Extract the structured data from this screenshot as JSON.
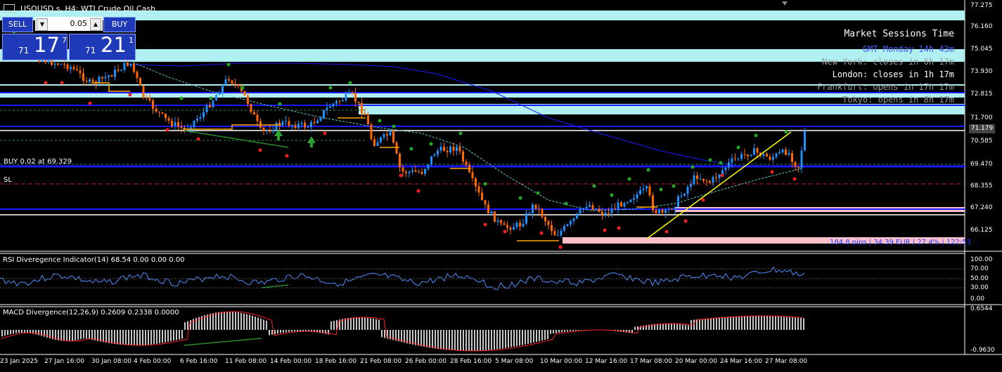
{
  "window": {
    "symbol_title": "USOUSD.s, H4:  WTI Crude Oil Cash"
  },
  "trade_panel": {
    "sell_label": "SELL",
    "buy_label": "BUY",
    "lot_value": "0.05",
    "sell_price_small": "71",
    "sell_price_big": "17",
    "sell_price_sup": "7",
    "buy_price_small": "71",
    "buy_price_big": "21",
    "buy_price_sup": "1"
  },
  "sessions": {
    "title": "Market Sessions Time",
    "gmt": "GMT Monday 14h 43m",
    "new_york": "New York: closes in 6h 17m",
    "london": "London: closes in 1h 17m",
    "frankfurt": "Frankfurt: opens in 17h 17m",
    "tokyo": "Tokyo: opens in 8h 17m"
  },
  "levels": {
    "buy_label": "BUY 0.02 at 69.329",
    "sl_label": "SL",
    "pips_label": "184.8 pips | 34.39 EUR | 27.4% | 122:53"
  },
  "price_axis": {
    "labels": [
      "77.275",
      "76.160",
      "75.045",
      "73.930",
      "72.815",
      "71.700",
      "70.585",
      "69.470",
      "68.355",
      "67.240",
      "66.125"
    ],
    "current_price": "71.179"
  },
  "rsi": {
    "title": "RSI Diveregence Indicator(14) 68.54 0.00 0.00 0.00",
    "levels": [
      "100.00",
      "70.00",
      "50.00",
      "30.00",
      "0.00"
    ]
  },
  "macd": {
    "title": "MACD Divergence(12,26,9) 0.2609 0.2338 0.0000",
    "levels": [
      "0.6544",
      "-0.9630"
    ]
  },
  "time_axis": {
    "labels": [
      "23 Jan 2025",
      "27 Jan 16:00",
      "30 Jan 08:00",
      "4 Feb 00:00",
      "6 Feb 16:00",
      "11 Feb 08:00",
      "14 Feb 00:00",
      "18 Feb 16:00",
      "21 Feb 08:00",
      "26 Feb 00:00",
      "28 Feb 16:00",
      "5 Mar 08:00",
      "10 Mar 00:00",
      "12 Mar 16:00",
      "17 Mar 08:00",
      "20 Mar 00:00",
      "24 Mar 16:00",
      "27 Mar 08:00"
    ]
  },
  "colors": {
    "background": "#000000",
    "bull_candle": "#1e90ff",
    "bear_candle": "#ff6600",
    "zone_cyan": "#b0f0f0",
    "zone_pink": "#ffc0cb",
    "level_blue": "#1a1aff",
    "trend_yellow": "#ffff00"
  }
}
